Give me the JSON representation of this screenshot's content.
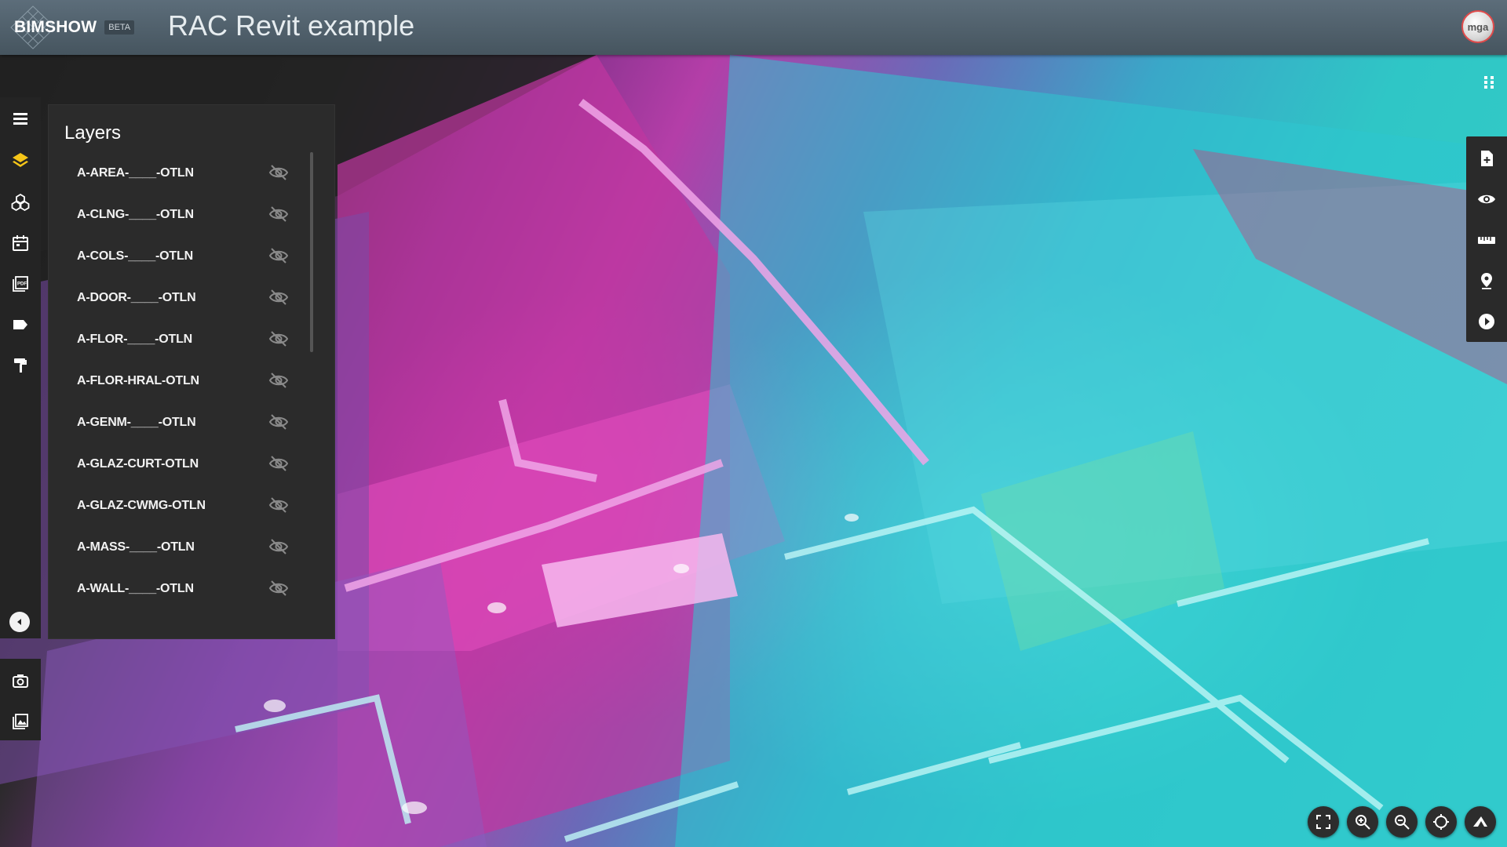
{
  "header": {
    "app_name": "BIMSHOW",
    "badge": "BETA",
    "project_title": "RAC Revit example",
    "avatar_text": "mga"
  },
  "left_toolbar": {
    "items": [
      {
        "icon": "list-icon"
      },
      {
        "icon": "layers-icon",
        "active": true
      },
      {
        "icon": "objects-icon"
      },
      {
        "icon": "calendar-icon"
      },
      {
        "icon": "pdf-icon"
      },
      {
        "icon": "tag-icon"
      },
      {
        "icon": "paint-roller-icon"
      }
    ],
    "bottom_items": [
      {
        "icon": "camera-icon"
      },
      {
        "icon": "gallery-icon"
      }
    ]
  },
  "layers_panel": {
    "title": "Layers",
    "items": [
      {
        "name": "A-AREA-____-OTLN"
      },
      {
        "name": "A-CLNG-____-OTLN"
      },
      {
        "name": "A-COLS-____-OTLN"
      },
      {
        "name": "A-DOOR-____-OTLN"
      },
      {
        "name": "A-FLOR-____-OTLN"
      },
      {
        "name": "A-FLOR-HRAL-OTLN"
      },
      {
        "name": "A-GENM-____-OTLN"
      },
      {
        "name": "A-GLAZ-CURT-OTLN"
      },
      {
        "name": "A-GLAZ-CWMG-OTLN"
      },
      {
        "name": "A-MASS-____-OTLN"
      },
      {
        "name": "A-WALL-____-OTLN"
      }
    ]
  },
  "right_toolbar": {
    "items": [
      {
        "icon": "add-document-icon"
      },
      {
        "icon": "eye-icon"
      },
      {
        "icon": "ruler-icon"
      },
      {
        "icon": "location-pin-icon"
      },
      {
        "icon": "play-icon"
      }
    ]
  },
  "nav_controls": [
    {
      "icon": "fullscreen-icon"
    },
    {
      "icon": "zoom-in-icon"
    },
    {
      "icon": "zoom-out-icon"
    },
    {
      "icon": "target-icon"
    },
    {
      "icon": "perspective-icon"
    }
  ],
  "colors": {
    "accent": "#f5c518",
    "header_bg": "#56656f",
    "panel_bg": "#2b2b2b",
    "toolbar_bg": "#242424"
  }
}
